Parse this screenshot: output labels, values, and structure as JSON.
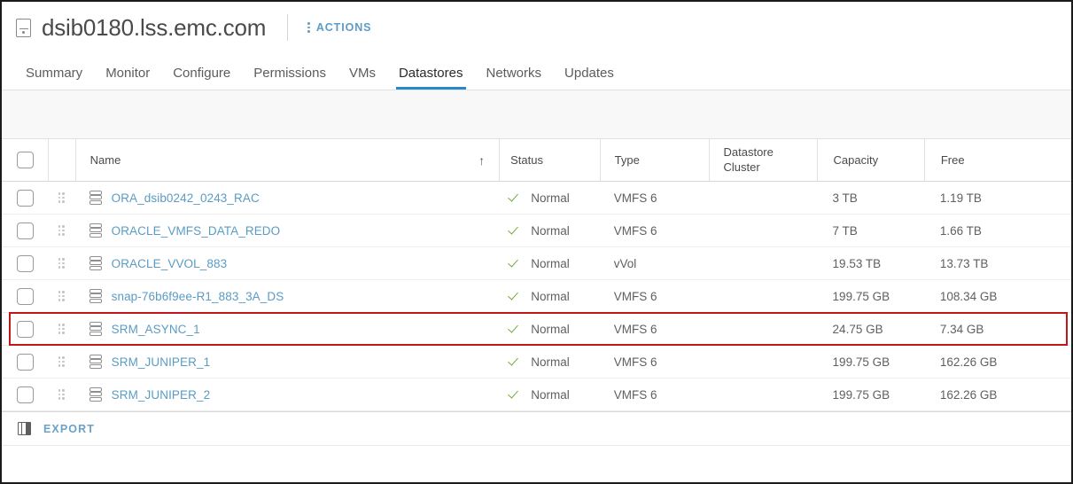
{
  "header": {
    "host_icon": "host-icon",
    "title": "dsib0180.lss.emc.com",
    "actions_label": "ACTIONS",
    "kebab_icon": "vertical-kebab-icon"
  },
  "tabs": [
    {
      "label": "Summary",
      "active": false
    },
    {
      "label": "Monitor",
      "active": false
    },
    {
      "label": "Configure",
      "active": false
    },
    {
      "label": "Permissions",
      "active": false
    },
    {
      "label": "VMs",
      "active": false
    },
    {
      "label": "Datastores",
      "active": true
    },
    {
      "label": "Networks",
      "active": false
    },
    {
      "label": "Updates",
      "active": false
    }
  ],
  "table": {
    "columns": {
      "name": "Name",
      "status": "Status",
      "type": "Type",
      "datastore_cluster_line1": "Datastore",
      "datastore_cluster_line2": "Cluster",
      "capacity": "Capacity",
      "free": "Free"
    },
    "sort": {
      "column": "Name",
      "direction": "ascending",
      "glyph": "↑"
    },
    "select_all_checkbox": false,
    "rows": [
      {
        "name": "ORA_dsib0242_0243_RAC",
        "status": "Normal",
        "type": "VMFS 6",
        "datastore_cluster": "",
        "capacity": "3 TB",
        "free": "1.19 TB",
        "checked": false,
        "highlighted": false
      },
      {
        "name": "ORACLE_VMFS_DATA_REDO",
        "status": "Normal",
        "type": "VMFS 6",
        "datastore_cluster": "",
        "capacity": "7 TB",
        "free": "1.66 TB",
        "checked": false,
        "highlighted": false
      },
      {
        "name": "ORACLE_VVOL_883",
        "status": "Normal",
        "type": "vVol",
        "datastore_cluster": "",
        "capacity": "19.53 TB",
        "free": "13.73 TB",
        "checked": false,
        "highlighted": false
      },
      {
        "name": "snap-76b6f9ee-R1_883_3A_DS",
        "status": "Normal",
        "type": "VMFS 6",
        "datastore_cluster": "",
        "capacity": "199.75 GB",
        "free": "108.34 GB",
        "checked": false,
        "highlighted": true
      },
      {
        "name": "SRM_ASYNC_1",
        "status": "Normal",
        "type": "VMFS 6",
        "datastore_cluster": "",
        "capacity": "24.75 GB",
        "free": "7.34 GB",
        "checked": false,
        "highlighted": false
      },
      {
        "name": "SRM_JUNIPER_1",
        "status": "Normal",
        "type": "VMFS 6",
        "datastore_cluster": "",
        "capacity": "199.75 GB",
        "free": "162.26 GB",
        "checked": false,
        "highlighted": false
      },
      {
        "name": "SRM_JUNIPER_2",
        "status": "Normal",
        "type": "VMFS 6",
        "datastore_cluster": "",
        "capacity": "199.75 GB",
        "free": "162.26 GB",
        "checked": false,
        "highlighted": false
      }
    ]
  },
  "footer": {
    "columns_icon": "column-chooser-icon",
    "export_label": "EXPORT"
  },
  "colors": {
    "accent_blue": "#2a87c8",
    "link_blue": "#5a9cc4",
    "status_green": "#74ab3c",
    "highlight_red": "#c0171a",
    "toolbar_gray": "#f8f8f8"
  },
  "icons": {
    "row_datastore": "datastore-icon",
    "row_drag": "drag-handle-icon",
    "status_ok": "check-icon"
  }
}
